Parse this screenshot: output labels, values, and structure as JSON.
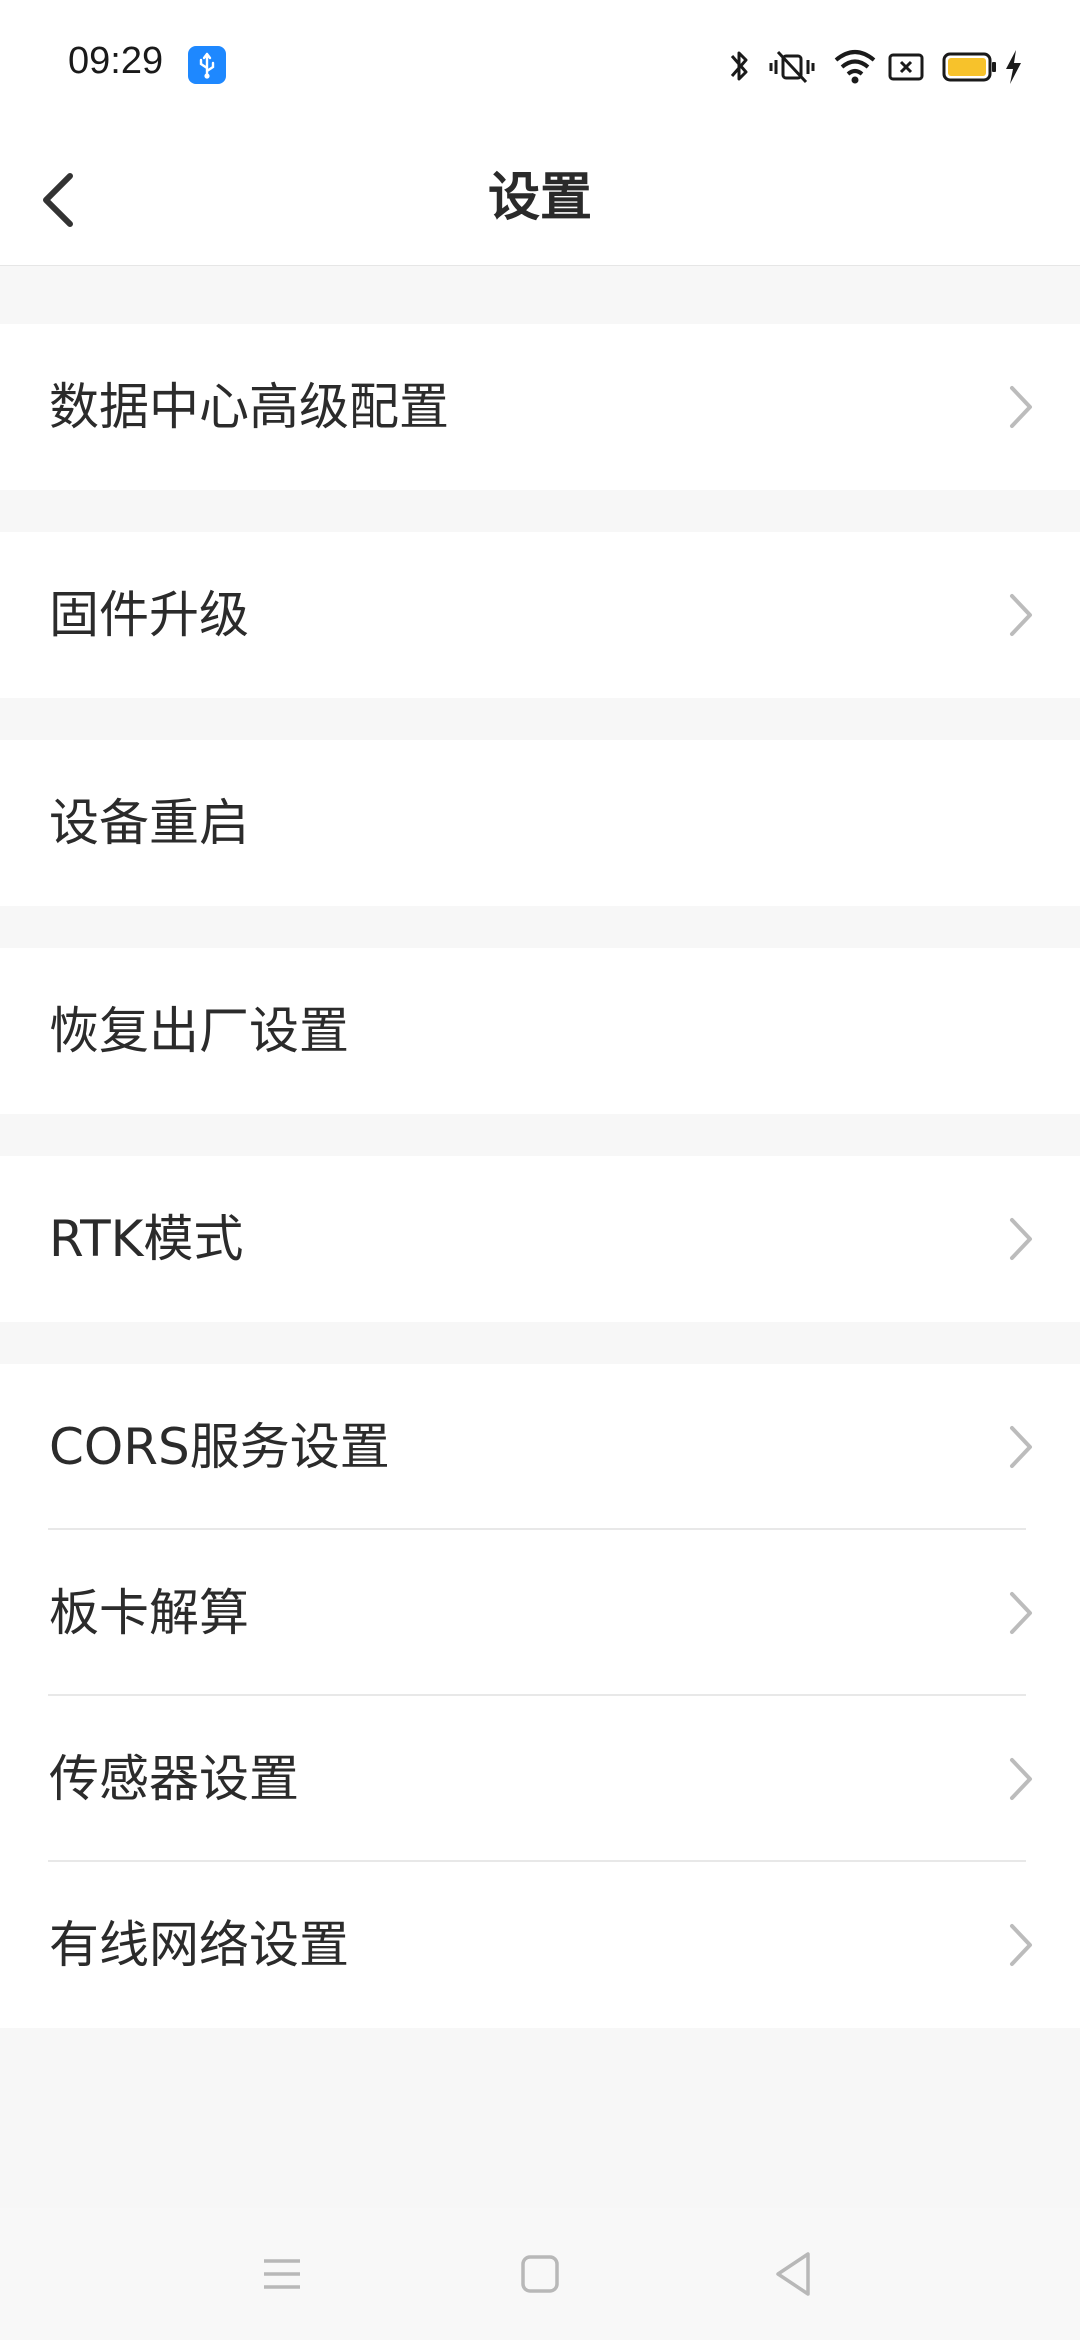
{
  "status_bar": {
    "time": "09:29",
    "icons": [
      "usb-icon",
      "bluetooth-icon",
      "vibrate-mute-icon",
      "wifi-icon",
      "sim-error-icon",
      "battery-icon",
      "charging-icon"
    ],
    "battery_color": "#f7c22b"
  },
  "header": {
    "title": "设置",
    "back_icon": "chevron-left-icon"
  },
  "settings": {
    "items": [
      {
        "label": "数据中心高级配置",
        "has_chevron": true
      },
      {
        "label": "固件升级",
        "has_chevron": true
      },
      {
        "label": "设备重启",
        "has_chevron": false
      },
      {
        "label": "恢复出厂设置",
        "has_chevron": false
      },
      {
        "label": "RTK模式",
        "has_chevron": true
      },
      {
        "label": "CORS服务设置",
        "has_chevron": true
      },
      {
        "label": "板卡解算",
        "has_chevron": true
      },
      {
        "label": "传感器设置",
        "has_chevron": true
      },
      {
        "label": "有线网络设置",
        "has_chevron": true
      }
    ]
  },
  "nav_bar": {
    "buttons": [
      "menu-icon",
      "home-icon",
      "back-triangle-icon"
    ]
  },
  "colors": {
    "accent_usb": "#1e88ff",
    "background": "#f7f7f7",
    "row_background": "#ffffff"
  }
}
